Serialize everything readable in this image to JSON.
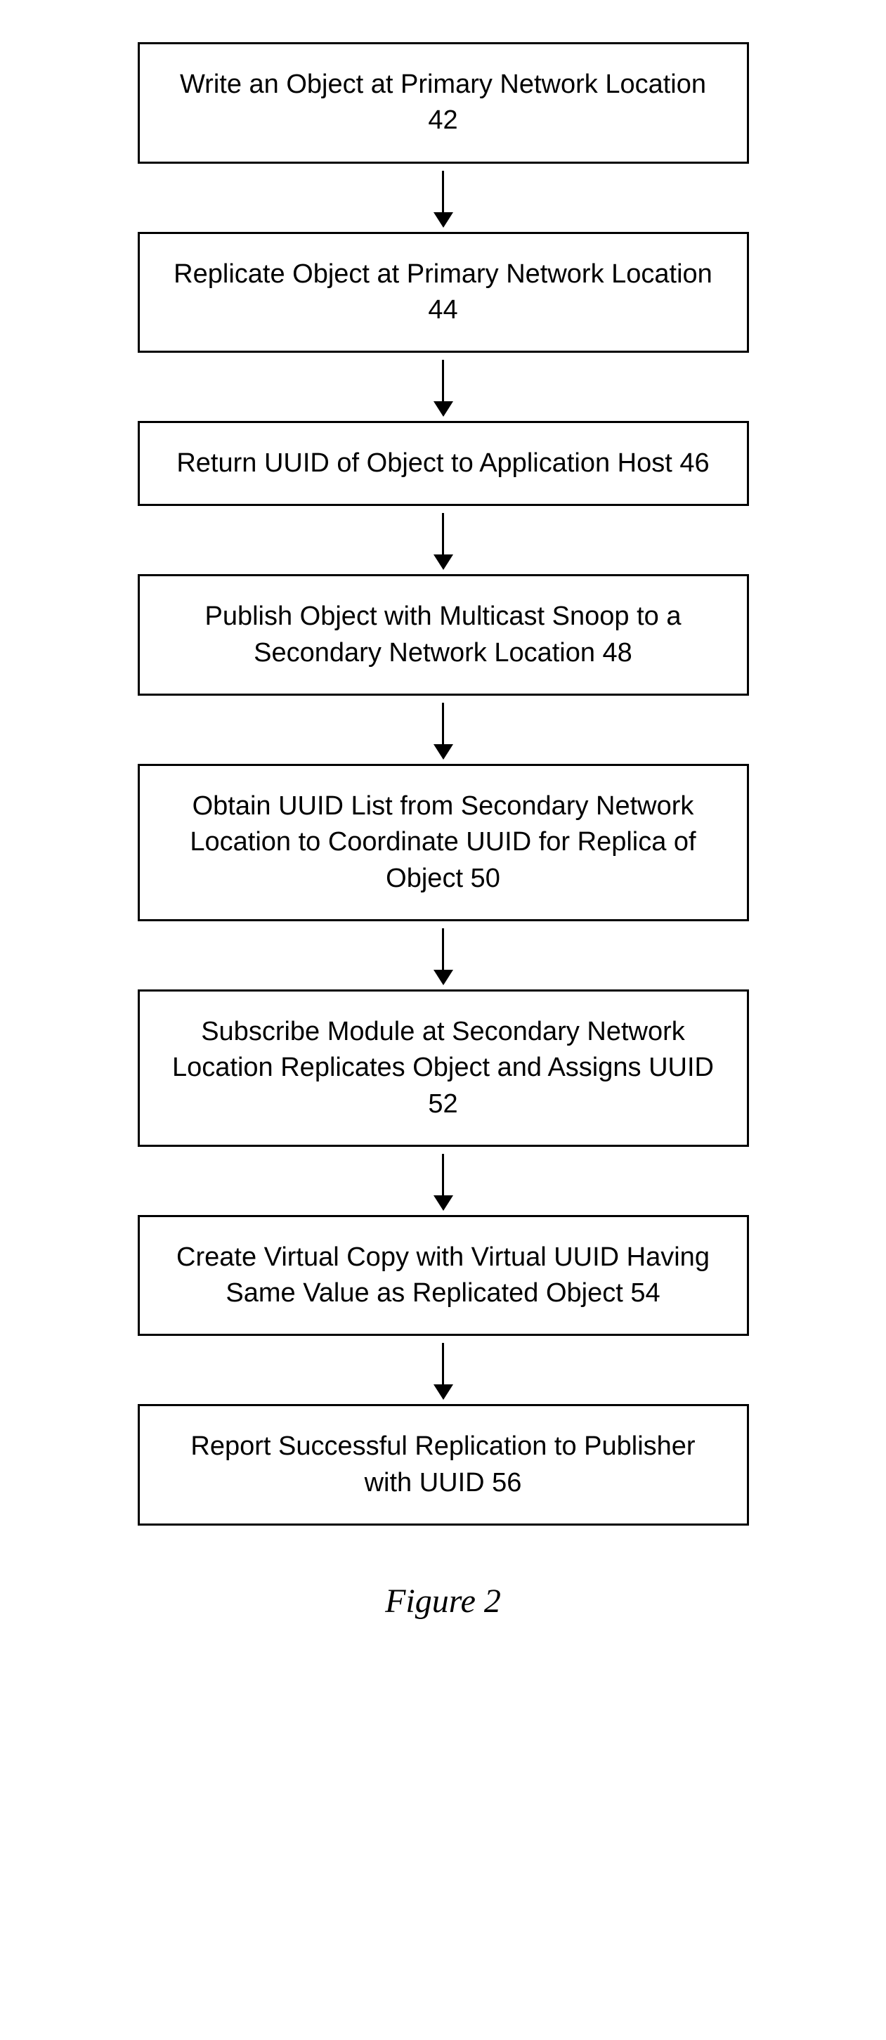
{
  "steps": [
    {
      "text": "Write an Object at Primary Network Location 42"
    },
    {
      "text": "Replicate Object at Primary Network Location 44"
    },
    {
      "text": "Return UUID of Object to Application Host 46"
    },
    {
      "text": "Publish Object with Multicast Snoop to a Secondary Network Location 48"
    },
    {
      "text": "Obtain UUID List from Secondary Network Location to Coordinate UUID for Replica of Object 50"
    },
    {
      "text": "Subscribe Module at Secondary Network Location Replicates Object and Assigns UUID 52"
    },
    {
      "text": "Create Virtual Copy with Virtual UUID Having Same Value as Replicated Object 54"
    },
    {
      "text": "Report Successful Replication to Publisher with UUID 56"
    }
  ],
  "caption": "Figure 2"
}
